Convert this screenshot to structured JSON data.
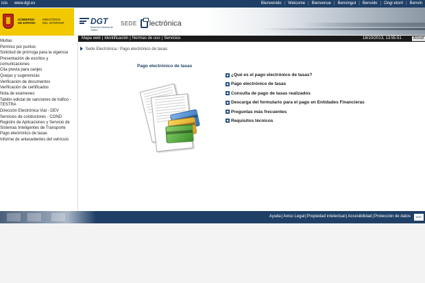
{
  "topbar": {
    "left": [
      "icio",
      "www.dgt.es"
    ],
    "right": [
      "Bienvenido",
      "Welcome",
      "Bienvenue",
      "Benvingut",
      "Benvido",
      "Ongi etorri",
      "Benvin"
    ]
  },
  "header": {
    "gov_line1": "GOBIERNO",
    "gov_line2": "DE ESPAÑA",
    "ministry_line1": "MINISTERIO",
    "ministry_line2": "DEL INTERIOR",
    "dgt_brand": "DGT",
    "dgt_sub": "Dirección General de Tráfico",
    "sede_text": "SEDE",
    "electronica_text": "lectrónica"
  },
  "navbar": {
    "links": [
      "Mapa web",
      "Identificación",
      "Normas de uso",
      "Servicios"
    ],
    "datetime": "18/10/2013, 13:55:51",
    "actual_label": "Actual"
  },
  "sidebar": {
    "items": [
      "Multas",
      "Permiso por puntos",
      "Solicitud de prórroga para la vigencia",
      "Presentación de escritos y comunicaciones",
      "Cita previa para canjes",
      "Quejas y sugerencias",
      "Verificación de documentos",
      "Verificación de certificados",
      "Nota de exámenes",
      "Tablón edictal de sanciones de tráfico - TESTRA",
      "Dirección Electrónica Vial - DEV",
      "Servicios de conductores - COND",
      "Registro de Aplicaciones y Servicio de Sistemas Inteligentes de Transporte",
      "Pago electrónico de tasas",
      "Informe de antecedentes del vehículo"
    ]
  },
  "breadcrumb": {
    "home": "Sede Electrónica",
    "current": "Pago electrónico de tasas"
  },
  "main": {
    "title": "Pago electrónico de tasas",
    "links": [
      "¿Qué es el pago electrónico de tasas?",
      "Pago electrónico de tasas",
      "Consulta de pago de tasas realizados",
      "Descarga del formulario para el pago en Entidades Financieras",
      "Preguntas más frecuentes",
      "Requisitos técnicos"
    ]
  },
  "footer": {
    "links": [
      "Ayuda",
      "Aviso Legal",
      "Propiedad intelectual",
      "Accesibilidad",
      "Protección de datos"
    ],
    "badge": "W3C"
  },
  "colors": {
    "brand_blue": "#1f3f66",
    "gov_yellow": "#f2c800",
    "navbar_black": "#1a1a1a"
  }
}
